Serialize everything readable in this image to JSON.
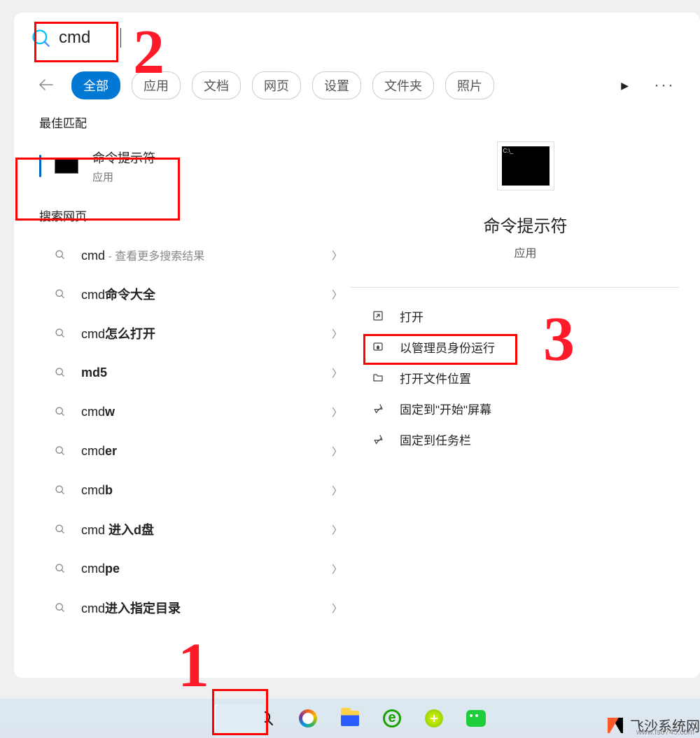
{
  "search": {
    "value": "cmd"
  },
  "tabs": [
    "全部",
    "应用",
    "文档",
    "网页",
    "设置",
    "文件夹",
    "照片"
  ],
  "activeTab": 0,
  "sections": {
    "bestMatch": "最佳匹配",
    "webSearch": "搜索网页"
  },
  "bestMatch": {
    "title": "命令提示符",
    "subtitle": "应用"
  },
  "webResults": [
    {
      "pre": "cmd",
      "bold": "",
      "suffix": " - 查看更多搜索结果"
    },
    {
      "pre": "cmd",
      "bold": "命令大全",
      "suffix": ""
    },
    {
      "pre": "cmd",
      "bold": "怎么打开",
      "suffix": ""
    },
    {
      "pre": "",
      "bold": "md5",
      "suffix": ""
    },
    {
      "pre": "cmd",
      "bold": "w",
      "suffix": ""
    },
    {
      "pre": "cmd",
      "bold": "er",
      "suffix": ""
    },
    {
      "pre": "cmd",
      "bold": "b",
      "suffix": ""
    },
    {
      "pre": "cmd ",
      "bold": "进入d盘",
      "suffix": ""
    },
    {
      "pre": "cmd",
      "bold": "pe",
      "suffix": ""
    },
    {
      "pre": "cmd",
      "bold": "进入指定目录",
      "suffix": ""
    }
  ],
  "preview": {
    "title": "命令提示符",
    "subtitle": "应用"
  },
  "actions": [
    {
      "icon": "open",
      "label": "打开"
    },
    {
      "icon": "shield",
      "label": "以管理员身份运行"
    },
    {
      "icon": "folder",
      "label": "打开文件位置"
    },
    {
      "icon": "pin",
      "label": "固定到\"开始\"屏幕"
    },
    {
      "icon": "pin",
      "label": "固定到任务栏"
    }
  ],
  "annotations": {
    "one": "1",
    "two": "2",
    "three": "3"
  },
  "watermark": {
    "main": "飞沙系统网",
    "sub": "www.fs0745.com"
  },
  "colors": {
    "accent": "#0078d4",
    "annotation": "#ff0000"
  }
}
